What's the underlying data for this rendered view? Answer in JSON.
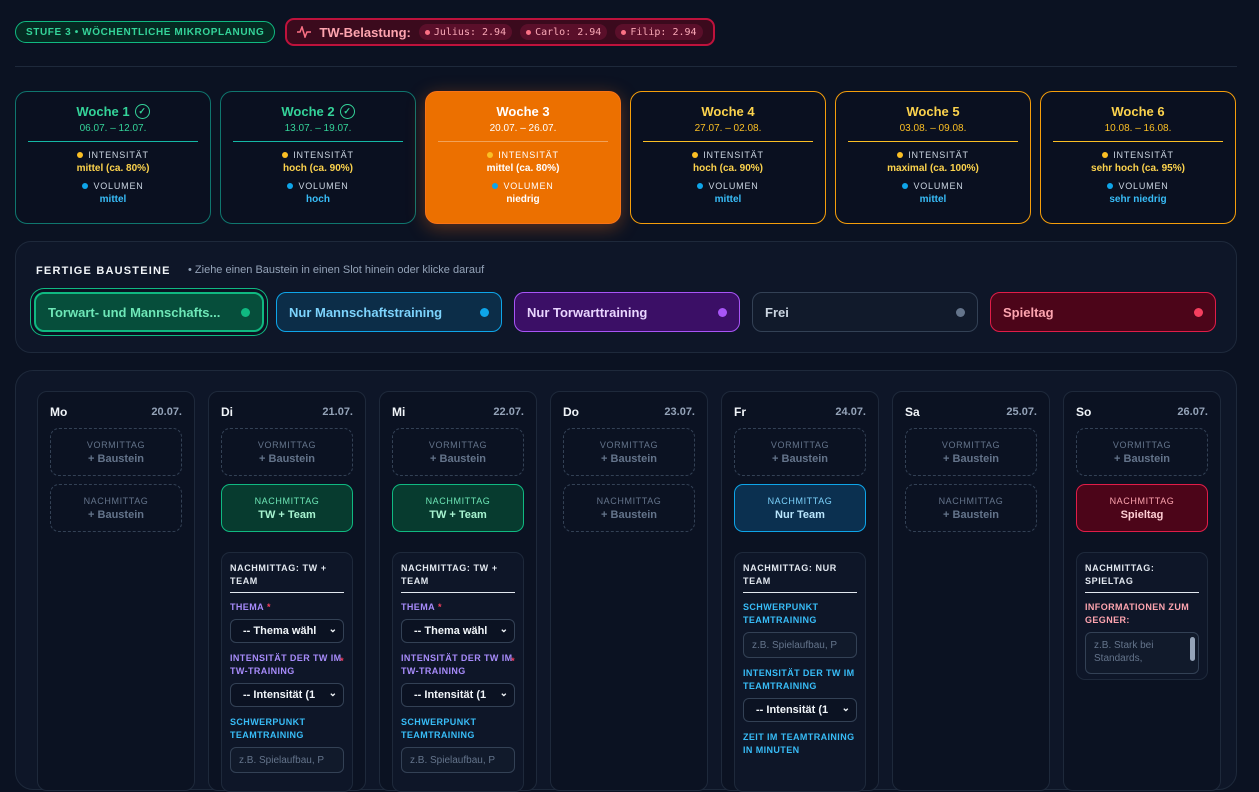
{
  "header": {
    "stage": "STUFE 3 • WÖCHENTLICHE MIKROPLANUNG",
    "load_label": "TW-Belastung:",
    "load_chips": [
      "Julius: 2.94",
      "Carlo: 2.94",
      "Filip: 2.94"
    ]
  },
  "labels": {
    "intensity": "INTENSITÄT",
    "volume": "VOLUMEN"
  },
  "weeks": [
    {
      "title": "Woche 1",
      "dates": "06.07. – 12.07.",
      "intensity": "mittel (ca. 80%)",
      "volume": "mittel",
      "state": "done"
    },
    {
      "title": "Woche 2",
      "dates": "13.07. – 19.07.",
      "intensity": "hoch (ca. 90%)",
      "volume": "hoch",
      "state": "done"
    },
    {
      "title": "Woche 3",
      "dates": "20.07. – 26.07.",
      "intensity": "mittel (ca. 80%)",
      "volume": "niedrig",
      "state": "active"
    },
    {
      "title": "Woche 4",
      "dates": "27.07. – 02.08.",
      "intensity": "hoch (ca. 90%)",
      "volume": "mittel",
      "state": "open"
    },
    {
      "title": "Woche 5",
      "dates": "03.08. – 09.08.",
      "intensity": "maximal (ca. 100%)",
      "volume": "mittel",
      "state": "open"
    },
    {
      "title": "Woche 6",
      "dates": "10.08. – 16.08.",
      "intensity": "sehr hoch (ca. 95%)",
      "volume": "sehr niedrig",
      "state": "open"
    }
  ],
  "blocks_panel": {
    "title": "FERTIGE BAUSTEINE",
    "hint": "• Ziehe einen Baustein in einen Slot hinein oder klicke darauf",
    "blocks": [
      "Torwart- und Mannschafts...",
      "Nur Mannschaftstraining",
      "Nur Torwarttraining",
      "Frei",
      "Spieltag"
    ]
  },
  "slot_labels": {
    "morning": "VORMITTAG",
    "afternoon": "NACHMITTAG",
    "add": "+ Baustein"
  },
  "days": [
    {
      "name": "Mo",
      "date": "20.07."
    },
    {
      "name": "Di",
      "date": "21.07.",
      "afternoon": "TW + Team"
    },
    {
      "name": "Mi",
      "date": "22.07.",
      "afternoon": "TW + Team"
    },
    {
      "name": "Do",
      "date": "23.07."
    },
    {
      "name": "Fr",
      "date": "24.07.",
      "afternoon": "Nur Team"
    },
    {
      "name": "Sa",
      "date": "25.07."
    },
    {
      "name": "So",
      "date": "26.07.",
      "afternoon": "Spieltag"
    }
  ],
  "form_tw_team": {
    "title": "NACHMITTAG: TW + TEAM",
    "thema_label": "THEMA",
    "thema_value": "-- Thema wähl",
    "intensity_label": "INTENSITÄT DER TW IM TW-TRAINING",
    "intensity_value": "-- Intensität (1",
    "focus_label": "SCHWERPUNKT TEAMTRAINING",
    "focus_placeholder": "z.B. Spielaufbau, P"
  },
  "form_team": {
    "title": "NACHMITTAG: NUR TEAM",
    "focus_label": "SCHWERPUNKT TEAMTRAINING",
    "focus_placeholder": "z.B. Spielaufbau, P",
    "intensity_label": "INTENSITÄT DER TW IM TEAMTRAINING",
    "intensity_value": "-- Intensität (1",
    "time_label": "ZEIT IM TEAMTRAINING IN MINUTEN"
  },
  "form_spiel": {
    "title": "NACHMITTAG: SPIELTAG",
    "info_label": "INFORMATIONEN ZUM GEGNER:",
    "info_placeholder": "z.B. Stark bei Standards,"
  },
  "colors": {
    "accent_orange": "#ec7000",
    "green": "#10b981",
    "blue": "#0ea5e9",
    "purple": "#a855f7",
    "red": "#e11d48"
  }
}
